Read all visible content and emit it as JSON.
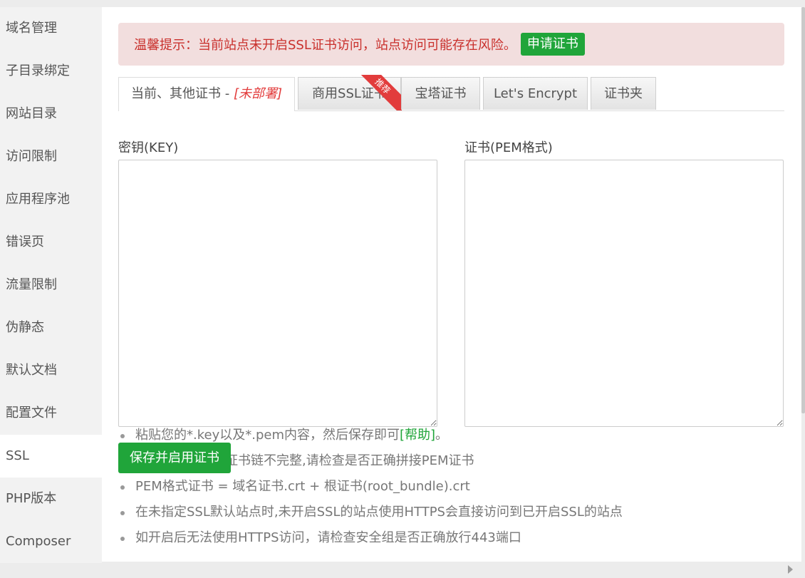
{
  "sidebar": {
    "items": [
      {
        "label": "域名管理"
      },
      {
        "label": "子目录绑定"
      },
      {
        "label": "网站目录"
      },
      {
        "label": "访问限制"
      },
      {
        "label": "应用程序池"
      },
      {
        "label": "错误页"
      },
      {
        "label": "流量限制"
      },
      {
        "label": "伪静态"
      },
      {
        "label": "默认文档"
      },
      {
        "label": "配置文件"
      },
      {
        "label": "SSL"
      },
      {
        "label": "PHP版本"
      },
      {
        "label": "Composer"
      }
    ],
    "active": "SSL"
  },
  "alert": {
    "message": "温馨提示：当前站点未开启SSL证书访问，站点访问可能存在风险。",
    "button_label": "申请证书"
  },
  "tabs": [
    {
      "label": "当前、其他证书 - ",
      "status": "[未部署]"
    },
    {
      "label": "商用SSL证书",
      "ribbon": "推荐"
    },
    {
      "label": "宝塔证书"
    },
    {
      "label": "Let's Encrypt"
    },
    {
      "label": "证书夹"
    }
  ],
  "form": {
    "key_label": "密钥(KEY)",
    "key_value": "",
    "cert_label": "证书(PEM格式)",
    "cert_value": "",
    "save_label": "保存并启用证书"
  },
  "tips": {
    "tip1_text": "粘贴您的*.key以及*.pem内容，然后保存即可",
    "tip1_link": "[帮助]",
    "tip1_end": "。",
    "tip2": "如果浏览器提示证书链不完整,请检查是否正确拼接PEM证书",
    "tip3": "PEM格式证书 = 域名证书.crt + 根证书(root_bundle).crt",
    "tip4": "在未指定SSL默认站点时,未开启SSL的站点使用HTTPS会直接访问到已开启SSL的站点",
    "tip5": "如开启后无法使用HTTPS访问，请检查安全组是否正确放行443端口"
  },
  "colors": {
    "accent": "#20a53a",
    "alert_bg": "#f2dede",
    "alert_text": "#c9302c",
    "ribbon": "#e23c3c"
  }
}
